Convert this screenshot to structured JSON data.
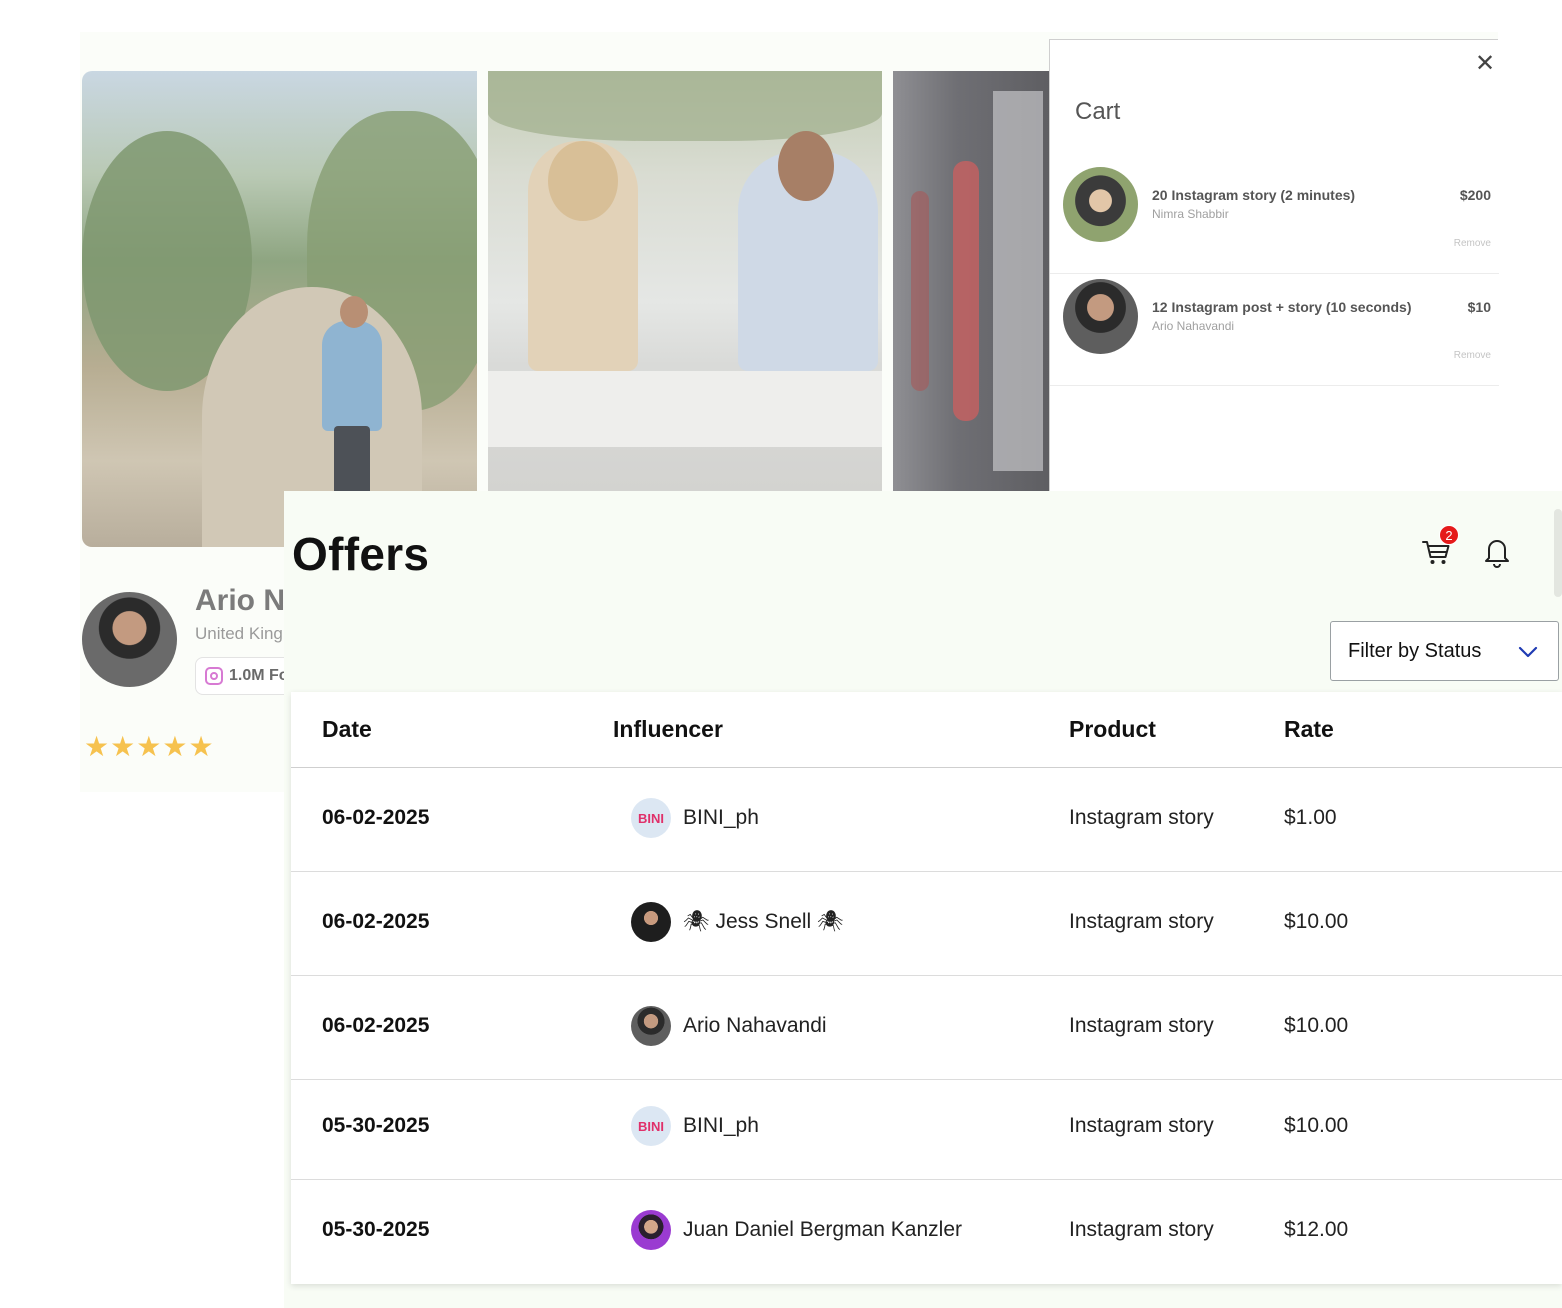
{
  "profile": {
    "name": "Ario Na",
    "country": "United King",
    "followers": "1.0M Fo",
    "rating_stars": 5
  },
  "cart": {
    "title": "Cart",
    "close_icon": "close-icon",
    "items": [
      {
        "title": "20 Instagram story (2 minutes)",
        "influencer": "Nimra Shabbir",
        "price": "$200",
        "remove_label": "Remove"
      },
      {
        "title": "12 Instagram post + story (10 seconds)",
        "influencer": "Ario Nahavandi",
        "price": "$10",
        "remove_label": "Remove"
      }
    ]
  },
  "offers": {
    "title": "Offers",
    "cart_badge_count": "2",
    "filter_label": "Filter by Status",
    "columns": {
      "date": "Date",
      "influencer": "Influencer",
      "product": "Product",
      "rate": "Rate"
    },
    "rows": [
      {
        "date": "06-02-2025",
        "influencer": "BINI_ph",
        "avatar_text": "BINI",
        "product": "Instagram story",
        "rate": "$1.00"
      },
      {
        "date": "06-02-2025",
        "influencer": "🕷 Jess Snell 🕷",
        "avatar_text": "",
        "product": "Instagram story",
        "rate": "$10.00"
      },
      {
        "date": "06-02-2025",
        "influencer": "Ario Nahavandi",
        "avatar_text": "",
        "product": "Instagram story",
        "rate": "$10.00"
      },
      {
        "date": "05-30-2025",
        "influencer": "BINI_ph",
        "avatar_text": "BINI",
        "product": "Instagram story",
        "rate": "$10.00"
      },
      {
        "date": "05-30-2025",
        "influencer": "Juan Daniel Bergman Kanzler",
        "avatar_text": "",
        "product": "Instagram story",
        "rate": "$12.00"
      }
    ]
  },
  "colors": {
    "badge": "#e51a1a",
    "chevron": "#1f3bb3",
    "stars": "#f6c24f",
    "instagram": "#d77ad3",
    "offers_bg": "#f8fcf5"
  }
}
